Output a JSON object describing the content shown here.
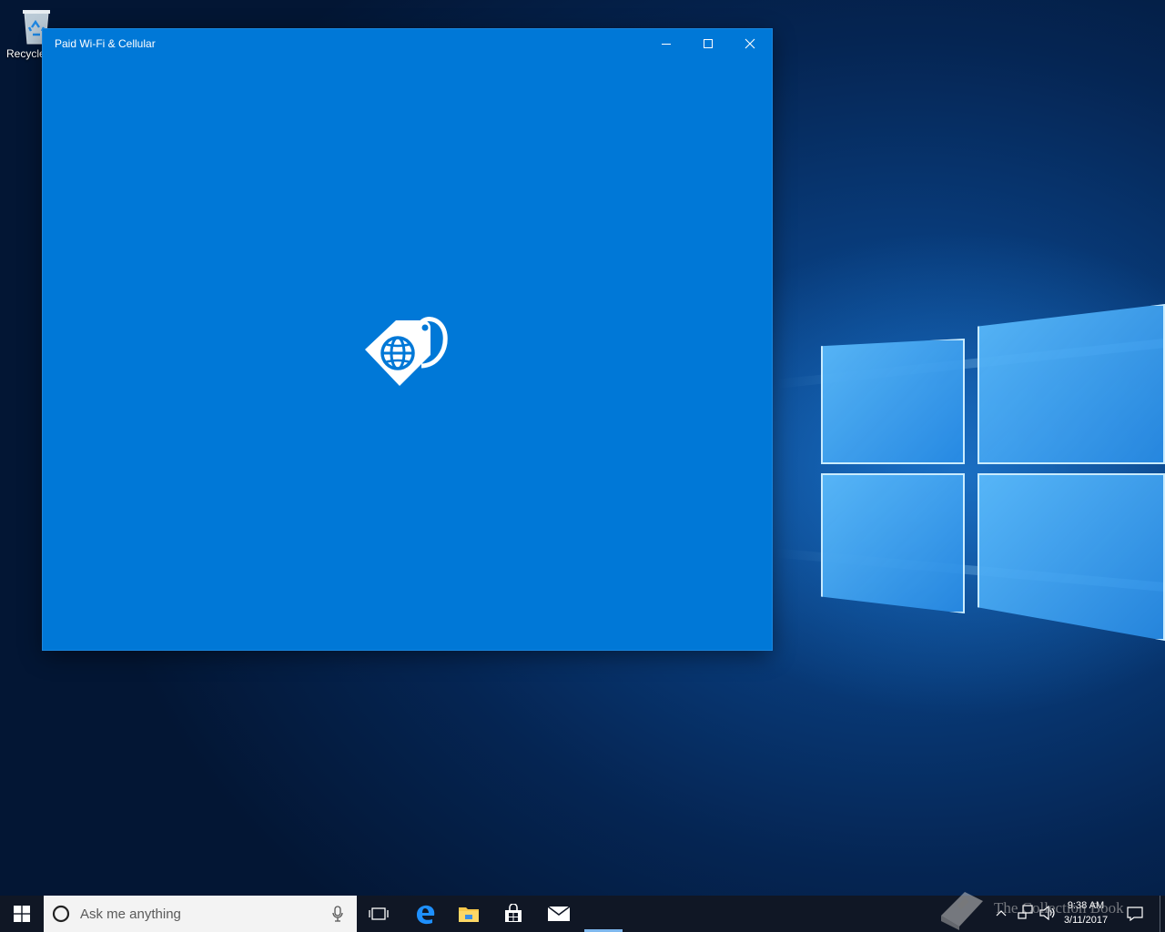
{
  "desktop": {
    "recycle_bin_label": "Recycle"
  },
  "window": {
    "title": "Paid Wi-Fi & Cellular",
    "accent_color": "#0078d7",
    "splash_icon": "sim-tag-globe-icon",
    "controls": {
      "minimize": "minimize-icon",
      "maximize": "maximize-icon",
      "close": "close-icon"
    }
  },
  "taskbar": {
    "search_placeholder": "Ask me anything",
    "pinned": [
      "task-view-icon",
      "edge-icon",
      "file-explorer-icon",
      "store-icon",
      "mail-icon"
    ],
    "clock": {
      "time": "9:38 AM",
      "date": "3/11/2017"
    }
  },
  "watermark": {
    "text": "The Collection Book"
  }
}
